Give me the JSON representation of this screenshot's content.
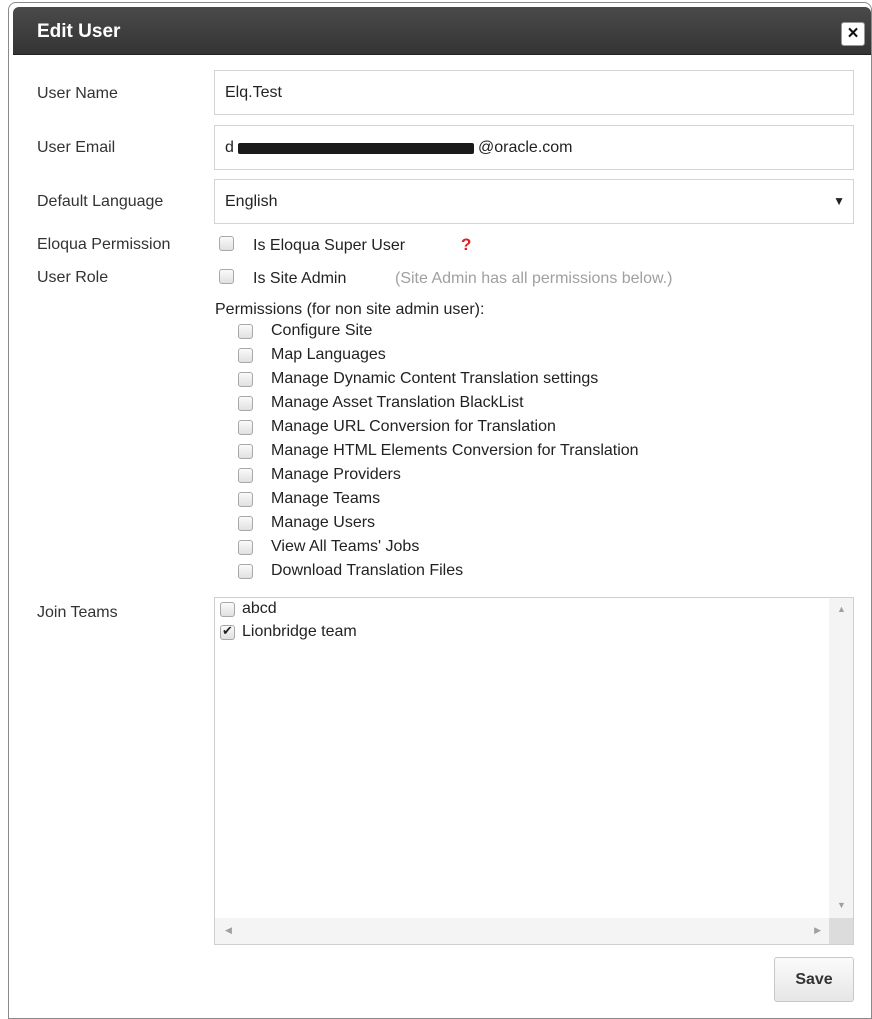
{
  "dialog": {
    "title": "Edit User",
    "close_icon": "×"
  },
  "form": {
    "user_name": {
      "label": "User Name",
      "value": "Elq.Test"
    },
    "user_email": {
      "label": "User Email",
      "value_prefix": "d",
      "value_suffix": "@oracle.com"
    },
    "default_language": {
      "label": "Default Language",
      "value": "English",
      "arrow": "▼"
    },
    "eloqua_permission": {
      "label": "Eloqua Permission",
      "checkbox_label": "Is Eloqua Super User",
      "checked": false,
      "help": "?"
    },
    "user_role": {
      "label": "User Role",
      "checkbox_label": "Is Site Admin",
      "checked": false,
      "note": "(Site Admin has all permissions below.)"
    },
    "permissions": {
      "heading": "Permissions (for non site admin user):",
      "items": [
        {
          "label": "Configure Site",
          "checked": false
        },
        {
          "label": "Map Languages",
          "checked": false
        },
        {
          "label": "Manage Dynamic Content Translation settings",
          "checked": false
        },
        {
          "label": "Manage Asset Translation BlackList",
          "checked": false
        },
        {
          "label": "Manage URL Conversion for Translation",
          "checked": false
        },
        {
          "label": "Manage HTML Elements Conversion for Translation",
          "checked": false
        },
        {
          "label": "Manage Providers",
          "checked": false
        },
        {
          "label": "Manage Teams",
          "checked": false
        },
        {
          "label": "Manage Users",
          "checked": false
        },
        {
          "label": "View All Teams' Jobs",
          "checked": false
        },
        {
          "label": "Download Translation Files",
          "checked": false
        }
      ]
    },
    "join_teams": {
      "label": "Join Teams",
      "teams": [
        {
          "label": "abcd",
          "checked": false
        },
        {
          "label": "Lionbridge team",
          "checked": true
        }
      ]
    }
  },
  "actions": {
    "save_label": "Save"
  },
  "icons": {
    "close": "close-icon",
    "dropdown": "chevron-down-icon",
    "help": "question-icon"
  },
  "colors": {
    "titlebar": "#3c3c3c",
    "help": "#e02020",
    "note": "#a0a0a0"
  }
}
